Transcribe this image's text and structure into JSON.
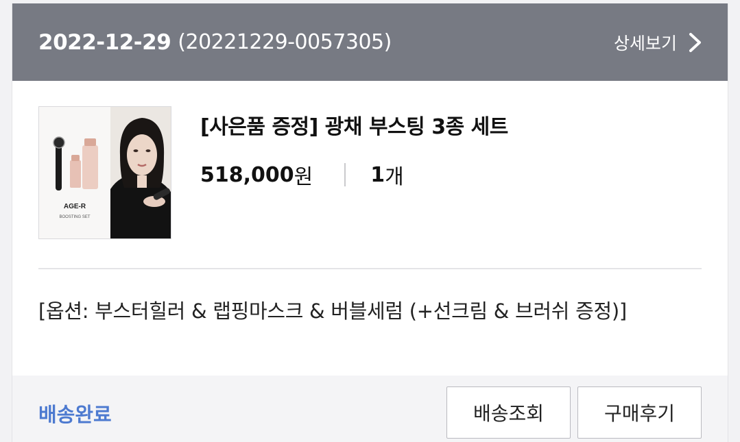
{
  "order": {
    "date": "2022-12-29",
    "number": "(20221229-0057305)",
    "detail_label": "상세보기",
    "detail_icon": "chevron-right-icon"
  },
  "product": {
    "name": "[사은품 증정] 광채 부스팅 3종 세트",
    "price": "518,000",
    "price_unit": "원",
    "quantity": "1",
    "quantity_unit": "개",
    "thumbnail": {
      "brand_text": "AGE-R",
      "sub_text": "BOOSTING SET"
    }
  },
  "option_text": "[옵션: 부스터힐러 & 랩핑마스크 & 버블세럼 (+선크림 & 브러쉬 증정)]",
  "footer": {
    "status": "배송완료",
    "track_button": "배송조회",
    "review_button": "구매후기"
  },
  "colors": {
    "header_bg": "#777a83",
    "status_blue": "#4d7ad0"
  }
}
